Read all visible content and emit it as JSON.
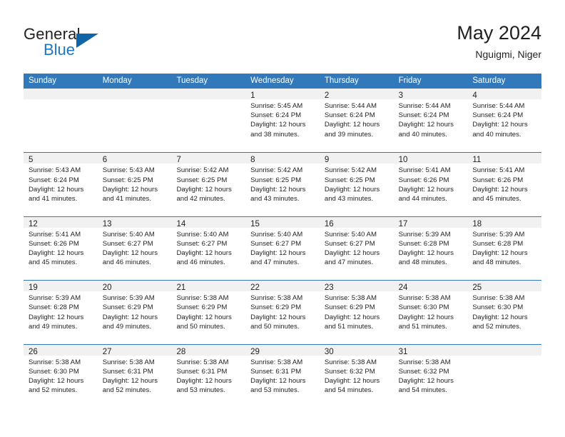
{
  "brand": {
    "word_general": "General",
    "word_blue": "Blue"
  },
  "title": {
    "month": "May 2024",
    "location": "Nguigmi, Niger"
  },
  "colors": {
    "header_blue": "#3279bc",
    "brand_blue": "#2176bd",
    "triangle_blue": "#1065a8",
    "daynum_strip": "#f1f1f1",
    "text": "#231f20"
  },
  "weekdays": [
    "Sunday",
    "Monday",
    "Tuesday",
    "Wednesday",
    "Thursday",
    "Friday",
    "Saturday"
  ],
  "weeks": [
    [
      {
        "day": "",
        "lines": []
      },
      {
        "day": "",
        "lines": []
      },
      {
        "day": "",
        "lines": []
      },
      {
        "day": "1",
        "lines": [
          "Sunrise: 5:45 AM",
          "Sunset: 6:24 PM",
          "Daylight: 12 hours",
          "and 38 minutes."
        ]
      },
      {
        "day": "2",
        "lines": [
          "Sunrise: 5:44 AM",
          "Sunset: 6:24 PM",
          "Daylight: 12 hours",
          "and 39 minutes."
        ]
      },
      {
        "day": "3",
        "lines": [
          "Sunrise: 5:44 AM",
          "Sunset: 6:24 PM",
          "Daylight: 12 hours",
          "and 40 minutes."
        ]
      },
      {
        "day": "4",
        "lines": [
          "Sunrise: 5:44 AM",
          "Sunset: 6:24 PM",
          "Daylight: 12 hours",
          "and 40 minutes."
        ]
      }
    ],
    [
      {
        "day": "5",
        "lines": [
          "Sunrise: 5:43 AM",
          "Sunset: 6:24 PM",
          "Daylight: 12 hours",
          "and 41 minutes."
        ]
      },
      {
        "day": "6",
        "lines": [
          "Sunrise: 5:43 AM",
          "Sunset: 6:25 PM",
          "Daylight: 12 hours",
          "and 41 minutes."
        ]
      },
      {
        "day": "7",
        "lines": [
          "Sunrise: 5:42 AM",
          "Sunset: 6:25 PM",
          "Daylight: 12 hours",
          "and 42 minutes."
        ]
      },
      {
        "day": "8",
        "lines": [
          "Sunrise: 5:42 AM",
          "Sunset: 6:25 PM",
          "Daylight: 12 hours",
          "and 43 minutes."
        ]
      },
      {
        "day": "9",
        "lines": [
          "Sunrise: 5:42 AM",
          "Sunset: 6:25 PM",
          "Daylight: 12 hours",
          "and 43 minutes."
        ]
      },
      {
        "day": "10",
        "lines": [
          "Sunrise: 5:41 AM",
          "Sunset: 6:26 PM",
          "Daylight: 12 hours",
          "and 44 minutes."
        ]
      },
      {
        "day": "11",
        "lines": [
          "Sunrise: 5:41 AM",
          "Sunset: 6:26 PM",
          "Daylight: 12 hours",
          "and 45 minutes."
        ]
      }
    ],
    [
      {
        "day": "12",
        "lines": [
          "Sunrise: 5:41 AM",
          "Sunset: 6:26 PM",
          "Daylight: 12 hours",
          "and 45 minutes."
        ]
      },
      {
        "day": "13",
        "lines": [
          "Sunrise: 5:40 AM",
          "Sunset: 6:27 PM",
          "Daylight: 12 hours",
          "and 46 minutes."
        ]
      },
      {
        "day": "14",
        "lines": [
          "Sunrise: 5:40 AM",
          "Sunset: 6:27 PM",
          "Daylight: 12 hours",
          "and 46 minutes."
        ]
      },
      {
        "day": "15",
        "lines": [
          "Sunrise: 5:40 AM",
          "Sunset: 6:27 PM",
          "Daylight: 12 hours",
          "and 47 minutes."
        ]
      },
      {
        "day": "16",
        "lines": [
          "Sunrise: 5:40 AM",
          "Sunset: 6:27 PM",
          "Daylight: 12 hours",
          "and 47 minutes."
        ]
      },
      {
        "day": "17",
        "lines": [
          "Sunrise: 5:39 AM",
          "Sunset: 6:28 PM",
          "Daylight: 12 hours",
          "and 48 minutes."
        ]
      },
      {
        "day": "18",
        "lines": [
          "Sunrise: 5:39 AM",
          "Sunset: 6:28 PM",
          "Daylight: 12 hours",
          "and 48 minutes."
        ]
      }
    ],
    [
      {
        "day": "19",
        "lines": [
          "Sunrise: 5:39 AM",
          "Sunset: 6:28 PM",
          "Daylight: 12 hours",
          "and 49 minutes."
        ]
      },
      {
        "day": "20",
        "lines": [
          "Sunrise: 5:39 AM",
          "Sunset: 6:29 PM",
          "Daylight: 12 hours",
          "and 49 minutes."
        ]
      },
      {
        "day": "21",
        "lines": [
          "Sunrise: 5:38 AM",
          "Sunset: 6:29 PM",
          "Daylight: 12 hours",
          "and 50 minutes."
        ]
      },
      {
        "day": "22",
        "lines": [
          "Sunrise: 5:38 AM",
          "Sunset: 6:29 PM",
          "Daylight: 12 hours",
          "and 50 minutes."
        ]
      },
      {
        "day": "23",
        "lines": [
          "Sunrise: 5:38 AM",
          "Sunset: 6:29 PM",
          "Daylight: 12 hours",
          "and 51 minutes."
        ]
      },
      {
        "day": "24",
        "lines": [
          "Sunrise: 5:38 AM",
          "Sunset: 6:30 PM",
          "Daylight: 12 hours",
          "and 51 minutes."
        ]
      },
      {
        "day": "25",
        "lines": [
          "Sunrise: 5:38 AM",
          "Sunset: 6:30 PM",
          "Daylight: 12 hours",
          "and 52 minutes."
        ]
      }
    ],
    [
      {
        "day": "26",
        "lines": [
          "Sunrise: 5:38 AM",
          "Sunset: 6:30 PM",
          "Daylight: 12 hours",
          "and 52 minutes."
        ]
      },
      {
        "day": "27",
        "lines": [
          "Sunrise: 5:38 AM",
          "Sunset: 6:31 PM",
          "Daylight: 12 hours",
          "and 52 minutes."
        ]
      },
      {
        "day": "28",
        "lines": [
          "Sunrise: 5:38 AM",
          "Sunset: 6:31 PM",
          "Daylight: 12 hours",
          "and 53 minutes."
        ]
      },
      {
        "day": "29",
        "lines": [
          "Sunrise: 5:38 AM",
          "Sunset: 6:31 PM",
          "Daylight: 12 hours",
          "and 53 minutes."
        ]
      },
      {
        "day": "30",
        "lines": [
          "Sunrise: 5:38 AM",
          "Sunset: 6:32 PM",
          "Daylight: 12 hours",
          "and 54 minutes."
        ]
      },
      {
        "day": "31",
        "lines": [
          "Sunrise: 5:38 AM",
          "Sunset: 6:32 PM",
          "Daylight: 12 hours",
          "and 54 minutes."
        ]
      },
      {
        "day": "",
        "lines": []
      }
    ]
  ]
}
